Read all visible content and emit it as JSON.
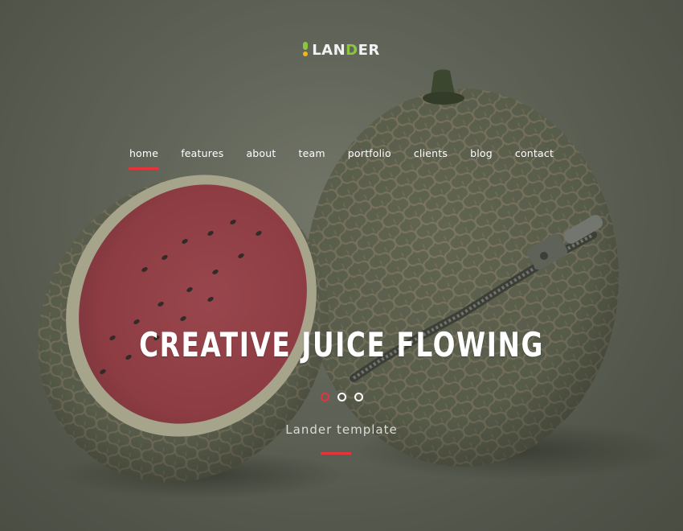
{
  "brand": {
    "name_start": "LAN",
    "name_accent": "D",
    "name_end": "ER",
    "accent_color": "#8cc63f"
  },
  "nav": {
    "items": [
      {
        "label": "home",
        "active": true
      },
      {
        "label": "features",
        "active": false
      },
      {
        "label": "about",
        "active": false
      },
      {
        "label": "team",
        "active": false
      },
      {
        "label": "portfolio",
        "active": false
      },
      {
        "label": "clients",
        "active": false
      },
      {
        "label": "blog",
        "active": false
      },
      {
        "label": "contact",
        "active": false
      }
    ],
    "active_color": "#e5343c"
  },
  "hero": {
    "headline": "CREATIVE JUICE FLOWING",
    "subtitle": "Lander template",
    "slides": 3,
    "active_slide": 1
  }
}
